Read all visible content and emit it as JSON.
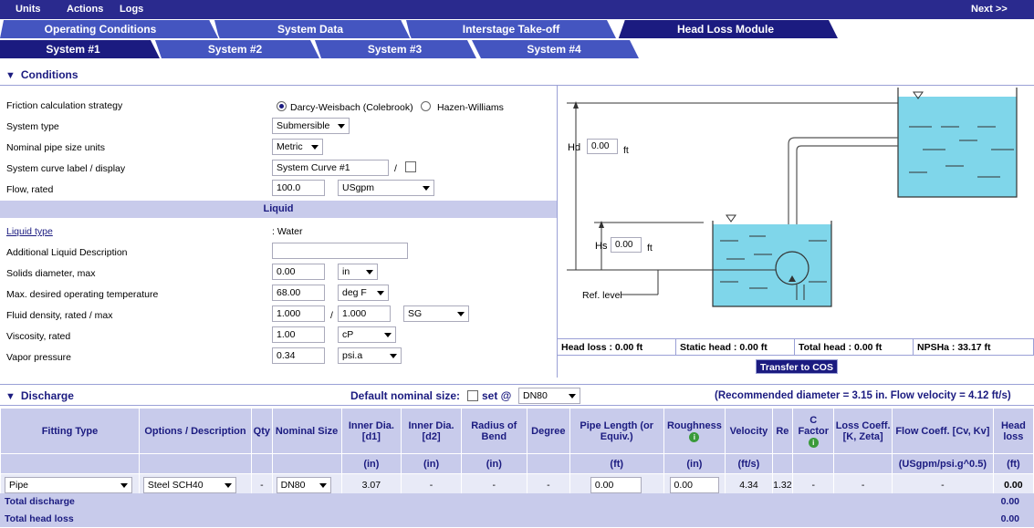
{
  "menu": {
    "units": "Units",
    "actions": "Actions",
    "logs": "Logs",
    "next": "Next >>"
  },
  "tabs_main": [
    "Operating Conditions",
    "System Data",
    "Interstage Take-off",
    "Head Loss Module"
  ],
  "tabs_system": [
    "System #1",
    "System #2",
    "System #3",
    "System #4"
  ],
  "conditions": {
    "title": "Conditions",
    "friction_label": "Friction calculation strategy",
    "friction_opt1": "Darcy-Weisbach (Colebrook)",
    "friction_opt2": "Hazen-Williams",
    "system_type_label": "System type",
    "system_type_value": "Submersible",
    "pipe_units_label": "Nominal pipe size units",
    "pipe_units_value": "Metric",
    "curve_label": "System curve label / display",
    "curve_value": "System Curve #1",
    "curve_sep": "/",
    "flow_label": "Flow, rated",
    "flow_value": "100.0",
    "flow_unit": "USgpm"
  },
  "liquid": {
    "title": "Liquid",
    "type_label": "Liquid type",
    "type_value": ": Water",
    "desc_label": "Additional Liquid Description",
    "solids_label": "Solids diameter, max",
    "solids_value": "0.00",
    "solids_unit": "in",
    "temp_label": "Max. desired operating temperature",
    "temp_value": "68.00",
    "temp_unit": "deg F",
    "density_label": "Fluid density, rated / max",
    "density_rated": "1.000",
    "density_sep": "/",
    "density_max": "1.000",
    "density_unit": "SG",
    "viscosity_label": "Viscosity, rated",
    "viscosity_value": "1.00",
    "viscosity_unit": "cP",
    "vapor_label": "Vapor pressure",
    "vapor_value": "0.34",
    "vapor_unit": "psi.a"
  },
  "diagram": {
    "hd_label": "Hd",
    "hd_value": "0.00",
    "hd_unit": "ft",
    "hs_label": "Hs",
    "hs_value": "0.00",
    "hs_unit": "ft",
    "ref_label": "Ref. level"
  },
  "stats": {
    "head_loss": "Head loss : 0.00 ft",
    "static_head": "Static head : 0.00 ft",
    "total_head": "Total head : 0.00 ft",
    "npsha": "NPSHa : 33.17 ft",
    "transfer": "Transfer to COS"
  },
  "discharge": {
    "title": "Discharge",
    "default_label": "Default nominal size:",
    "set_label": "set @",
    "nominal_value": "DN80",
    "recommend": "(Recommended diameter = 3.15 in. Flow velocity = 4.12 ft/s)"
  },
  "table": {
    "headers": [
      "Fitting Type",
      "Options / Description",
      "Qty",
      "Nominal Size",
      "Inner Dia. [d1]",
      "Inner Dia. [d2]",
      "Radius of Bend",
      "Degree",
      "Pipe Length (or Equiv.)",
      "Roughness",
      "Velocity",
      "Re",
      "C Factor",
      "Loss Coeff. [K, Zeta]",
      "Flow Coeff. [Cv, Kv]",
      "Head loss"
    ],
    "units": [
      "",
      "",
      "",
      "",
      "(in)",
      "(in)",
      "(in)",
      "",
      "(ft)",
      "(in)",
      "(ft/s)",
      "",
      "",
      "",
      "(USgpm/psi.g^0.5)",
      "(ft)"
    ],
    "row": {
      "fitting": "Pipe",
      "option": "Steel SCH40",
      "qty": "-",
      "nominal": "DN80",
      "d1": "3.07",
      "d2": "-",
      "radius": "-",
      "degree": "-",
      "length": "0.00",
      "roughness": "0.00",
      "velocity": "4.34",
      "re": "1.32",
      "cfactor": "-",
      "loss": "-",
      "flowcoeff": "-",
      "headloss": "0.00"
    }
  },
  "summary": {
    "total_discharge": "Total discharge",
    "total_discharge_value": "0.00",
    "total_head_loss": "Total head loss",
    "total_head_loss_value": "0.00"
  }
}
